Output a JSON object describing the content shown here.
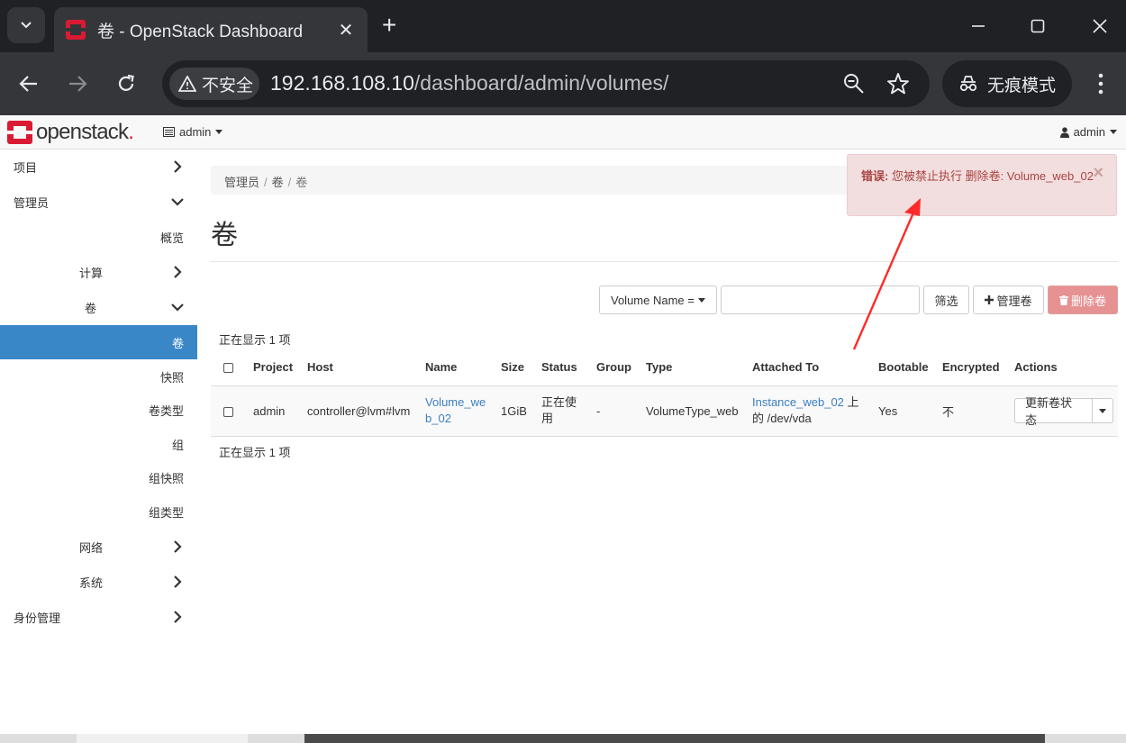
{
  "browser": {
    "tab_title": "卷 - OpenStack Dashboard",
    "tab_close": "✕",
    "new_tab": "+",
    "security_label": "不安全",
    "url_host": "192.168.108.10",
    "url_path": "/dashboard/admin/volumes/",
    "incognito_label": "无痕模式"
  },
  "header": {
    "logo_text": "openstack",
    "logo_dot": ".",
    "project_label": "admin",
    "user_label": "admin"
  },
  "sidebar": {
    "items": [
      {
        "label": "项目"
      },
      {
        "label": "管理员"
      },
      {
        "label": "概览"
      },
      {
        "label": "计算"
      },
      {
        "label": "卷"
      },
      {
        "label": "卷"
      },
      {
        "label": "快照"
      },
      {
        "label": "卷类型"
      },
      {
        "label": "组"
      },
      {
        "label": "组快照"
      },
      {
        "label": "组类型"
      },
      {
        "label": "网络"
      },
      {
        "label": "系统"
      },
      {
        "label": "身份管理"
      }
    ]
  },
  "breadcrumb": [
    "管理员",
    "卷",
    "卷"
  ],
  "page_title": "卷",
  "filter": {
    "field_label": "Volume Name =",
    "input_value": "",
    "filter_button": "筛选",
    "manage_button": "管理卷",
    "delete_button": "删除卷"
  },
  "count_text": "正在显示 1 项",
  "table": {
    "headers": [
      "Project",
      "Host",
      "Name",
      "Size",
      "Status",
      "Group",
      "Type",
      "Attached To",
      "Bootable",
      "Encrypted",
      "Actions"
    ],
    "rows": [
      {
        "project": "admin",
        "host": "controller@lvm#lvm",
        "name": "Volume_web_02",
        "size": "1GiB",
        "status": "正在使用",
        "group": "-",
        "type": "VolumeType_web",
        "attached_instance": "Instance_web_02",
        "attached_suffix": " 上的 /dev/vda",
        "bootable": "Yes",
        "encrypted": "不",
        "action_label": "更新卷状态"
      }
    ]
  },
  "alert": {
    "prefix": "错误:",
    "message": "您被禁止执行 删除卷: Volume_web_02",
    "close": "×"
  },
  "colors": {
    "accent": "#3a87c8",
    "danger_bg": "#f2dede",
    "danger_text": "#a94442",
    "link": "#3a7fc1",
    "annotation_arrow": "#ff2a2a"
  }
}
